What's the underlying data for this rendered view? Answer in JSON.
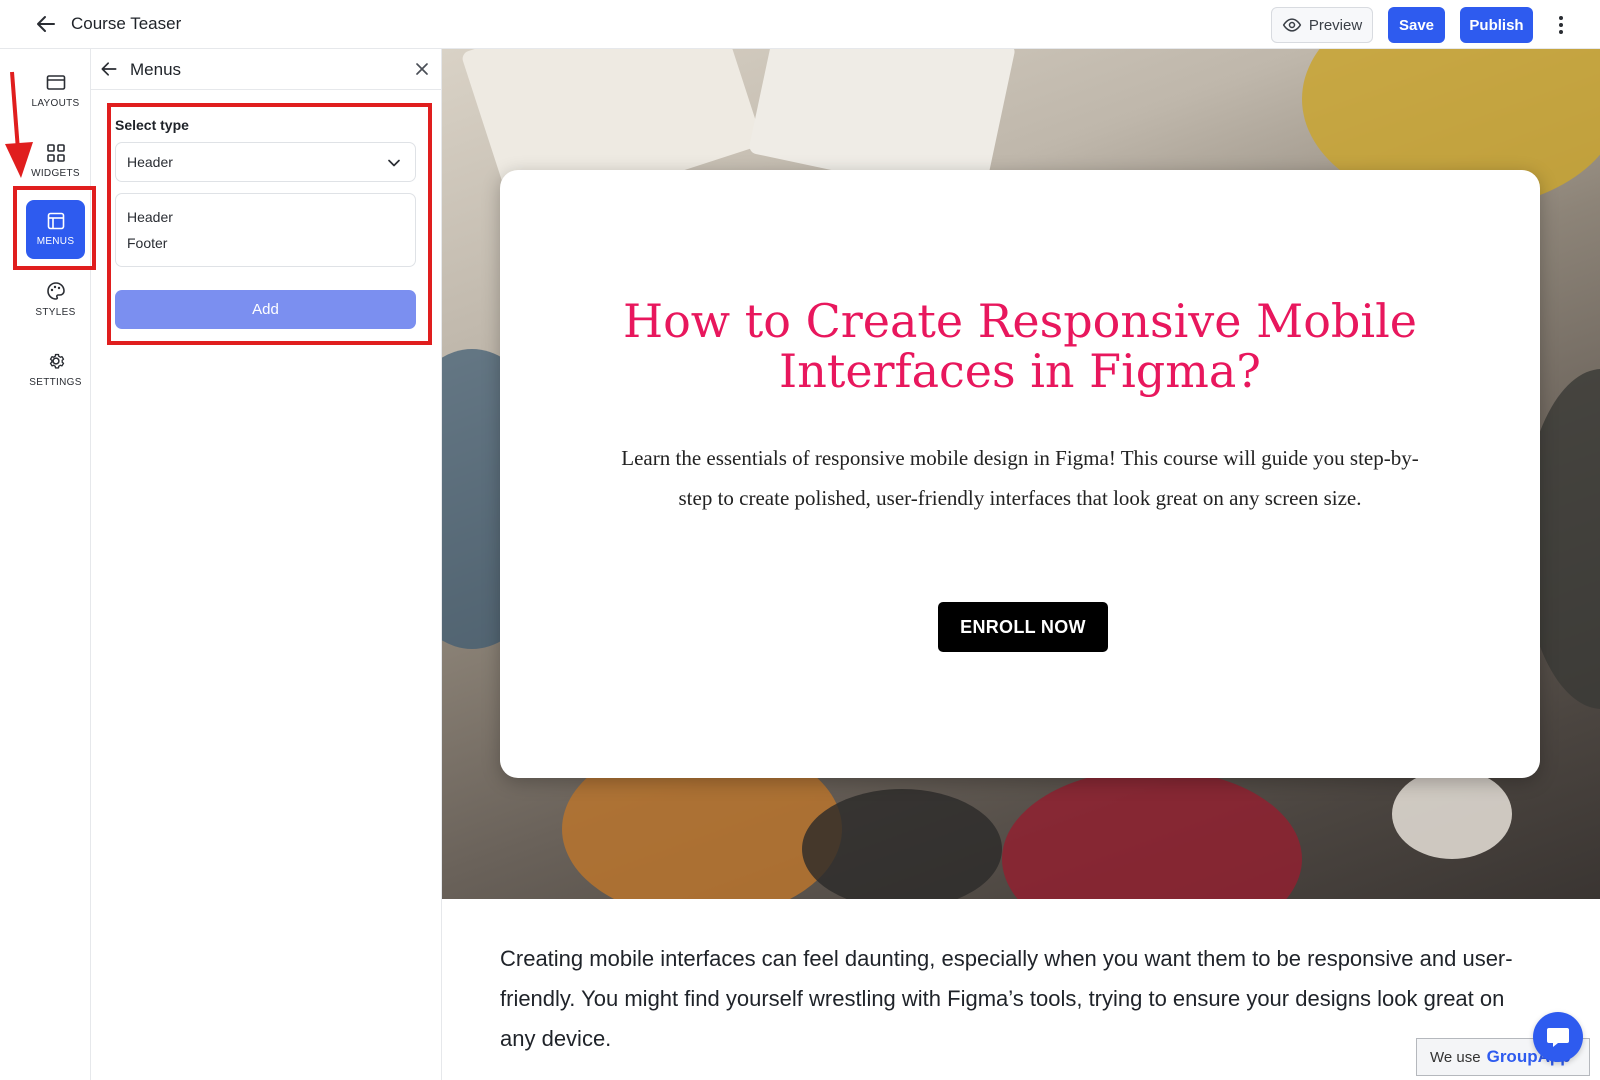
{
  "topbar": {
    "title": "Course Teaser",
    "preview_label": "Preview",
    "save_label": "Save",
    "publish_label": "Publish"
  },
  "rail": {
    "items": [
      {
        "label": "LAYOUTS",
        "icon": "layout-icon"
      },
      {
        "label": "WIDGETS",
        "icon": "grid-icon"
      },
      {
        "label": "MENUS",
        "icon": "menu-layout-icon",
        "active": true
      },
      {
        "label": "STYLES",
        "icon": "palette-icon"
      },
      {
        "label": "SETTINGS",
        "icon": "gear-icon"
      }
    ]
  },
  "panel": {
    "title": "Menus",
    "select_label": "Select type",
    "select_value": "Header",
    "options": [
      "Header",
      "Footer"
    ],
    "add_label": "Add"
  },
  "hero": {
    "title": "How to Create Responsive Mobile Interfaces in Figma?",
    "description": "Learn the essentials of responsive mobile design in Figma! This course will guide you step-by-step to create polished, user-friendly interfaces that look great on any screen size.",
    "cta_label": "ENROLL NOW"
  },
  "body": {
    "paragraph": "Creating mobile interfaces can feel daunting, especially when you want them to be responsive and user-friendly. You might find yourself wrestling with Figma’s tools, trying to ensure your designs look great on any device."
  },
  "widget": {
    "badge_prefix": "We use",
    "badge_brand": "GroupApp"
  },
  "colors": {
    "accent": "#2e5bef",
    "title_pink": "#e8175d",
    "annotation_red": "#e01e1e",
    "add_button": "#7b8ff0"
  }
}
